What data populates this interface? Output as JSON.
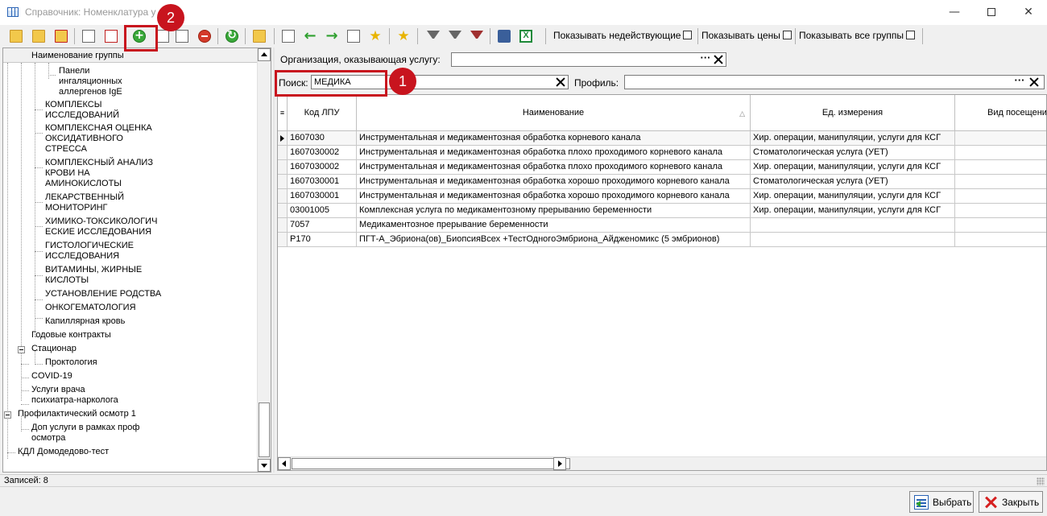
{
  "window": {
    "title": "Справочник: Номенклатура у"
  },
  "toolbar": {
    "checkboxes": [
      {
        "label": "Показывать недействующие"
      },
      {
        "label": "Показывать цены"
      },
      {
        "label": "Показывать все группы"
      }
    ]
  },
  "tree": {
    "header": "Наименование группы",
    "nodes": [
      {
        "label": "Панели\nингаляционных\nаллергенов IgE"
      },
      {
        "label": "КОМПЛЕКСЫ\nИССЛЕДОВАНИЙ"
      },
      {
        "label": "КОМПЛЕКСНАЯ ОЦЕНКА\nОКСИДАТИВНОГО\nСТРЕССА"
      },
      {
        "label": "КОМПЛЕКСНЫЙ АНАЛИЗ\nКРОВИ НА\nАМИНОКИСЛОТЫ"
      },
      {
        "label": "ЛЕКАРСТВЕННЫЙ\nМОНИТОРИНГ"
      },
      {
        "label": "ХИМИКО-ТОКСИКОЛОГИЧ\nЕСКИЕ ИССЛЕДОВАНИЯ"
      },
      {
        "label": "ГИСТОЛОГИЧЕСКИЕ\nИССЛЕДОВАНИЯ"
      },
      {
        "label": "ВИТАМИНЫ, ЖИРНЫЕ\nКИСЛОТЫ"
      },
      {
        "label": "УСТАНОВЛЕНИЕ РОДСТВА"
      },
      {
        "label": "ОНКОГЕМАТОЛОГИЯ"
      },
      {
        "label": "Капиллярная кровь"
      },
      {
        "label": "Годовые контракты"
      },
      {
        "label": "Стационар"
      },
      {
        "label": "Проктология"
      },
      {
        "label": "COVID-19"
      },
      {
        "label": "Услуги  врача\nпсихиатра-нарколога"
      },
      {
        "label": "Профилактический осмотр 1"
      },
      {
        "label": "Доп услуги в рамках проф\nосмотра"
      },
      {
        "label": "КДЛ Домодедово-тест"
      }
    ]
  },
  "filters": {
    "org_label": "Организация, оказывающая услугу:",
    "org_value": "",
    "search_label": "Поиск:",
    "search_value": "МЕДИКА",
    "profile_label": "Профиль:",
    "profile_value": "",
    "dots": "···"
  },
  "grid": {
    "columns": [
      "Код ЛПУ",
      "Наименование",
      "Ед. измерения",
      "Вид посещени"
    ],
    "sort_indicator": "△",
    "rows": [
      {
        "code": "1607030",
        "name": "Инструментальная и медикаментозная обработка корневого канала",
        "unit": "Хир. операции, манипуляции, услуги для КСГ",
        "visit": ""
      },
      {
        "code": "1607030002",
        "name": "Инструментальная и медикаментозная обработка плохо проходимого корневого канала",
        "unit": "Стоматологическая услуга (УЕТ)",
        "visit": ""
      },
      {
        "code": "1607030002",
        "name": "Инструментальная и медикаментозная обработка плохо проходимого корневого канала",
        "unit": "Хир. операции, манипуляции, услуги для КСГ",
        "visit": ""
      },
      {
        "code": "1607030001",
        "name": "Инструментальная и медикаментозная обработка хорошо проходимого корневого канала",
        "unit": "Стоматологическая услуга (УЕТ)",
        "visit": ""
      },
      {
        "code": "1607030001",
        "name": "Инструментальная и медикаментозная обработка хорошо проходимого корневого канала",
        "unit": "Хир. операции, манипуляции, услуги для КСГ",
        "visit": ""
      },
      {
        "code": "03001005",
        "name": "Комплексная услуга по медикаментозному прерыванию беременности",
        "unit": "Хир. операции, манипуляции, услуги для КСГ",
        "visit": ""
      },
      {
        "code": "7057",
        "name": "Медикаментозное прерывание беременности",
        "unit": "",
        "visit": ""
      },
      {
        "code": "P170",
        "name": "ПГТ-А_Эбриона(ов)_БиопсияВсех +ТестОдногоЭмбриона_Айдженомикс (5 эмбрионов)",
        "unit": "",
        "visit": ""
      }
    ]
  },
  "status": {
    "records_label": "Записей:  8"
  },
  "buttons": {
    "select": "Выбрать",
    "close": "Закрыть"
  },
  "annotations": {
    "callout1": "1",
    "callout2": "2",
    "color": "#c8141e"
  }
}
